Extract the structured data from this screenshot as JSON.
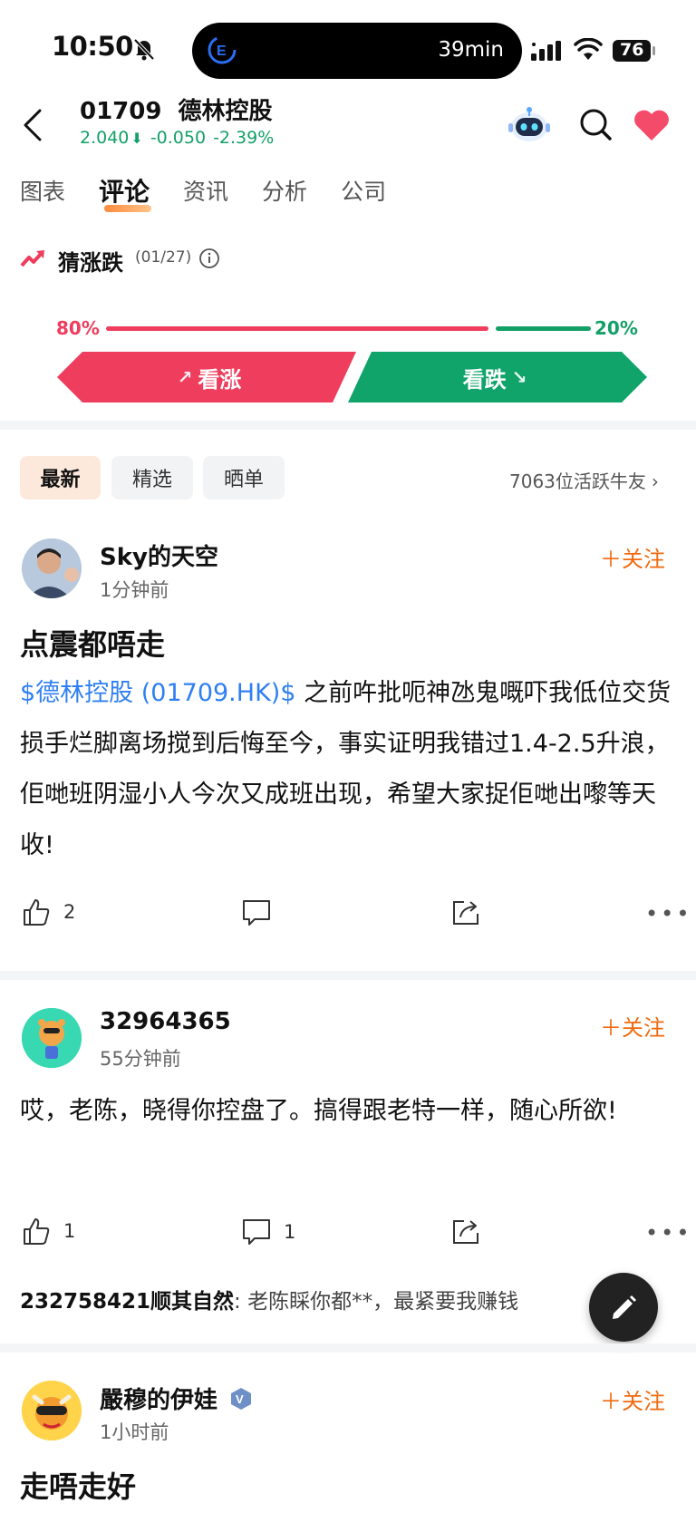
{
  "status_bar": {
    "time": "10:50",
    "timer": "39min",
    "battery": "76"
  },
  "header": {
    "code": "01709",
    "name": "德林控股",
    "price": "2.040",
    "change": "-0.050",
    "change_pct": "-2.39%"
  },
  "tabs": [
    "图表",
    "评论",
    "资讯",
    "分析",
    "公司"
  ],
  "active_tab": "评论",
  "guess": {
    "title": "猜涨跌",
    "date": "(01/27)",
    "up_pct": "80%",
    "down_pct": "20%",
    "up_label": "看涨",
    "down_label": "看跌",
    "up_fraction": 0.8
  },
  "filters": {
    "chips": [
      "最新",
      "精选",
      "晒单"
    ],
    "active_users": "7063位活跃牛友"
  },
  "posts": [
    {
      "username": "Sky的天空",
      "time": "1分钟前",
      "follow": "关注",
      "title": "点震都唔走",
      "link": "$德林控股 (01709.HK)$",
      "body": " 之前吘批呃神氹鬼嘅吓我低位交货损手烂脚离场搅到后悔至今，事实证明我错过1.4-2.5升浪，佢哋班阴湿小人今次又成班出现，希望大家捉佢哋出嚟等天收!",
      "likes": "2",
      "comments": ""
    },
    {
      "username": "32964365",
      "time": "55分钟前",
      "follow": "关注",
      "body": "哎，老陈，晓得你控盘了。搞得跟老特一样，随心所欲!",
      "likes": "1",
      "comments": "1",
      "reply": {
        "author": "232758421顺其自然",
        "text": ": 老陈睬你都**，最紧要我赚钱"
      }
    },
    {
      "username": "嚴穆的伊娃",
      "time": "1小时前",
      "follow": "关注",
      "title": "走唔走好"
    }
  ],
  "colors": {
    "up": "#ee3d5d",
    "down": "#13a067",
    "accent": "#f06a0f",
    "link": "#2f7ff3"
  }
}
